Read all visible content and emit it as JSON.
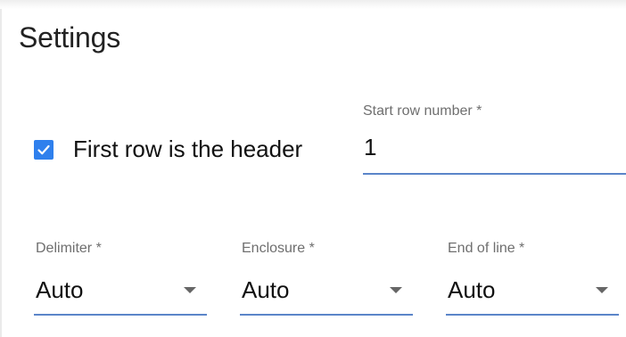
{
  "settings": {
    "title": "Settings",
    "header_checkbox": {
      "label": "First row is the header",
      "checked": true,
      "check_icon": "checkmark-icon",
      "color": "#2f80ed"
    },
    "start_row": {
      "label": "Start row number *",
      "value": "1"
    },
    "delimiter": {
      "label": "Delimiter *",
      "value": "Auto",
      "icon": "dropdown-arrow-icon"
    },
    "enclosure": {
      "label": "Enclosure *",
      "value": "Auto",
      "icon": "dropdown-arrow-icon"
    },
    "end_of_line": {
      "label": "End of line *",
      "value": "Auto",
      "icon": "dropdown-arrow-icon"
    },
    "underline_color": "#5b85c9"
  }
}
